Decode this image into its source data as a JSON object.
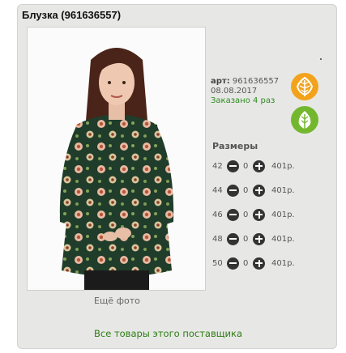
{
  "title": "Блузка (961636557)",
  "product": {
    "art_label": "арт:",
    "art_value": "961636557",
    "date": "08.08.2017",
    "ordered": "Заказано 4 раз"
  },
  "more_photo": "Ещё фото",
  "sizes_title": "Размеры",
  "sizes": [
    {
      "size": "42",
      "qty": "0",
      "price": "401р."
    },
    {
      "size": "44",
      "qty": "0",
      "price": "401р."
    },
    {
      "size": "46",
      "qty": "0",
      "price": "401р."
    },
    {
      "size": "48",
      "qty": "0",
      "price": "401р."
    },
    {
      "size": "50",
      "qty": "0",
      "price": "401р."
    }
  ],
  "supplier_link": "Все товары этого поставщика",
  "colors": {
    "accent_green": "#2e7d12",
    "badge_orange": "#f3a31b",
    "badge_green": "#73b72f"
  },
  "icons": [
    "autumn-leaf-icon",
    "green-leaf-icon",
    "minus-icon",
    "plus-icon"
  ]
}
